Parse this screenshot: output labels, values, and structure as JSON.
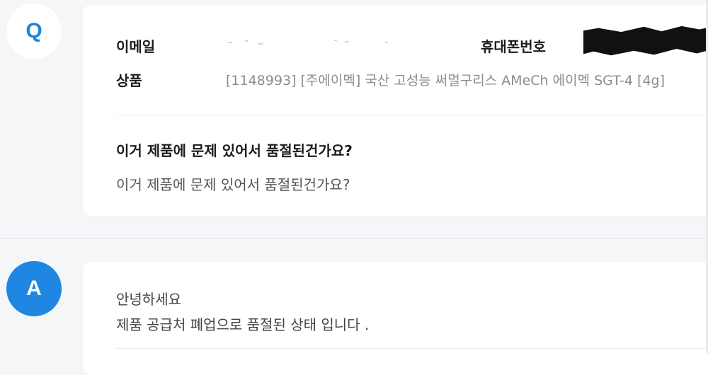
{
  "question": {
    "avatar_letter": "Q",
    "email_label": "이메일",
    "phone_label": "휴대폰번호",
    "product_label": "상품",
    "product_value": "[1148993] [주에이멕] 국산 고성능 써멀구리스 AMeCh 에이멕 SGT-4 [4g]",
    "title": "이거 제품에 문제 있어서 품절된건가요?",
    "body": "이거 제품에 문제 있어서 품절된건가요?"
  },
  "answer": {
    "avatar_letter": "A",
    "line1": "안녕하세요",
    "line2": "제품 공급처 폐업으로 품절된 상태 입니다 ."
  },
  "colors": {
    "background": "#f5f6f8",
    "accent_blue": "#1f86e2",
    "card": "#ffffff"
  }
}
